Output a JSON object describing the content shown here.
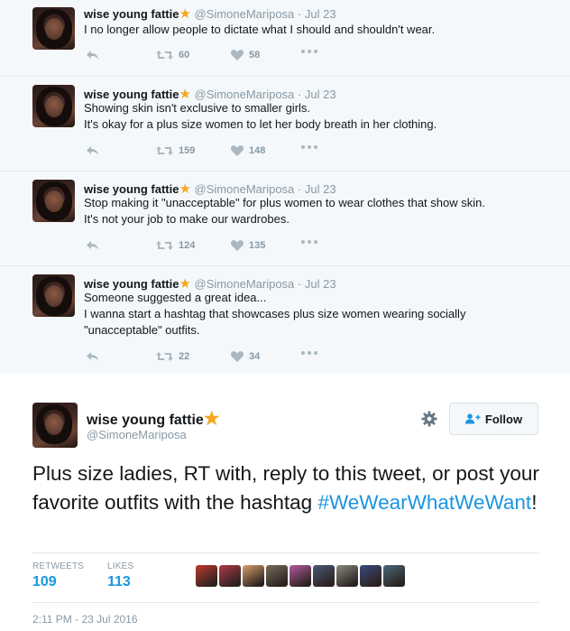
{
  "author": {
    "name": "wise young fattie",
    "handle": "@SimoneMariposa",
    "badge_icon": "star-icon",
    "badge_color": "#f5a623"
  },
  "thread": [
    {
      "date": "Jul 23",
      "lines": [
        "I no longer allow people to dictate what I should and shouldn't wear."
      ],
      "retweets": "60",
      "likes": "58"
    },
    {
      "date": "Jul 23",
      "lines": [
        "Showing skin isn't exclusive to smaller girls.",
        "It's okay for a plus size women to let her body breath in her clothing."
      ],
      "retweets": "159",
      "likes": "148"
    },
    {
      "date": "Jul 23",
      "lines": [
        "Stop making it \"unacceptable\" for plus women to wear clothes that show skin.",
        "It's not your job to make our wardrobes."
      ],
      "retweets": "124",
      "likes": "135"
    },
    {
      "date": "Jul 23",
      "lines": [
        "Someone suggested a great idea...",
        "I wanna start a hashtag that showcases plus size women wearing socially",
        "\"unacceptable\" outfits."
      ],
      "retweets": "22",
      "likes": "34"
    }
  ],
  "main_tweet": {
    "text_part1": "Plus size ladies, RT with, reply to this tweet, or post your favorite outfits with the hashtag ",
    "hashtag": "#WeWearWhatWeWant",
    "text_part2": "!",
    "follow_label": "Follow",
    "retweets_label": "RETWEETS",
    "retweets_value": "109",
    "likes_label": "LIKES",
    "likes_value": "113",
    "timestamp": "2:11 PM - 23 Jul 2016",
    "liker_colors": [
      "#c0392b",
      "#b03a48",
      "#d9a06b",
      "#7a6a58",
      "#b55a9e",
      "#4a5a78",
      "#8a8a80",
      "#3b4a7a",
      "#4a6a78"
    ]
  },
  "colors": {
    "link": "#1b95e0",
    "muted": "#8899a6",
    "background": "#f5f8fa"
  }
}
